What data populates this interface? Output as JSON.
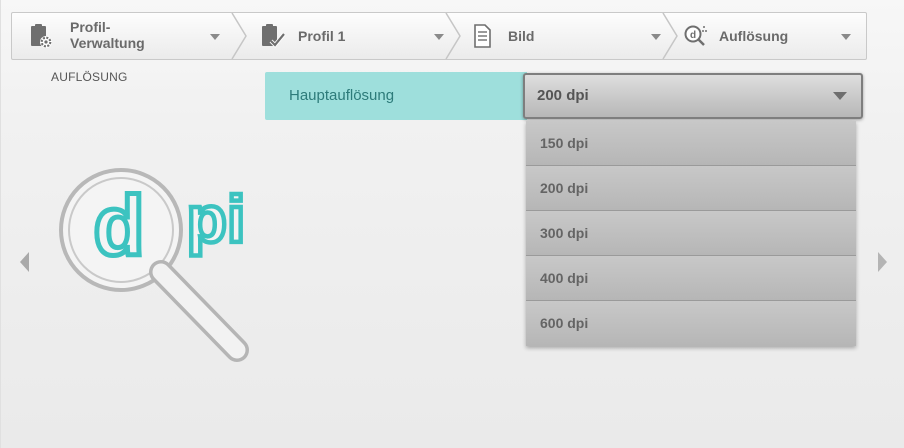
{
  "breadcrumb": {
    "items": [
      {
        "line1": "Profil-",
        "line2": "Verwaltung",
        "icon": "clipboard-gear-icon"
      },
      {
        "label": "Profil 1",
        "icon": "clipboard-check-icon"
      },
      {
        "label": "Bild",
        "icon": "document-icon"
      },
      {
        "label": "Auflösung",
        "icon": "resolution-icon"
      }
    ]
  },
  "section": {
    "title": "AUFLÖSUNG"
  },
  "setting": {
    "label": "Hauptauflösung",
    "selected": "200 dpi",
    "options": [
      "150 dpi",
      "200 dpi",
      "300 dpi",
      "400 dpi",
      "600 dpi"
    ]
  },
  "illustration": {
    "text_d": "d",
    "text_pi": "pi",
    "icon": "magnifier-dpi-icon"
  },
  "navigation": {
    "prev_icon": "chevron-left-icon",
    "next_icon": "chevron-right-icon"
  },
  "colors": {
    "accent": "#9edfdc",
    "accent_text": "#2d7b7a",
    "dpi_teal": "#3cc3c0"
  }
}
